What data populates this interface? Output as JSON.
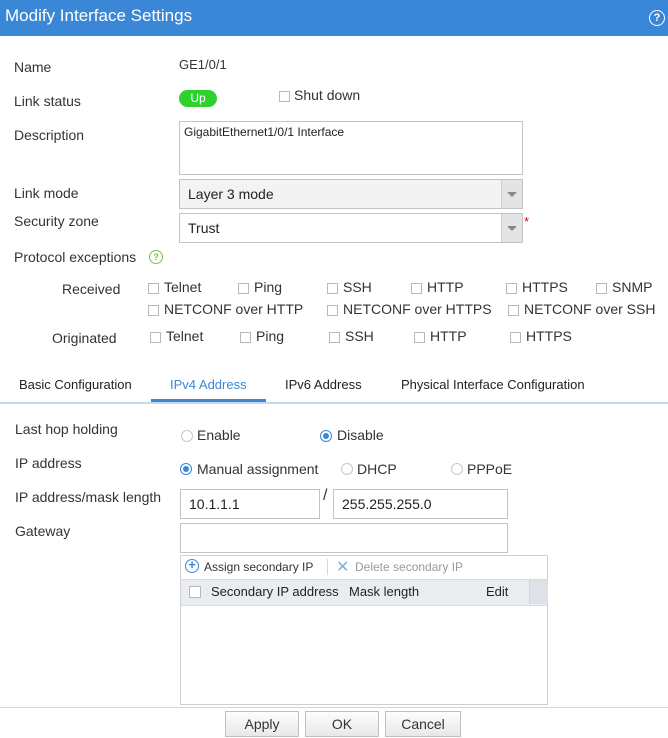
{
  "dialog": {
    "title": "Modify Interface Settings"
  },
  "form": {
    "name_label": "Name",
    "name_value": "GE1/0/1",
    "link_status_label": "Link status",
    "link_status_value": "Up",
    "shutdown_label": "Shut down",
    "description_label": "Description",
    "description_value": "GigabitEthernet1/0/1 Interface",
    "link_mode_label": "Link mode",
    "link_mode_value": "Layer 3 mode",
    "security_zone_label": "Security zone",
    "security_zone_value": "Trust",
    "required_mark": "*",
    "protocol_exceptions_label": "Protocol exceptions",
    "received_label": "Received",
    "received_row1": [
      "Telnet",
      "Ping",
      "SSH",
      "HTTP",
      "HTTPS",
      "SNMP"
    ],
    "received_row2": [
      "NETCONF over HTTP",
      "NETCONF over HTTPS",
      "NETCONF over SSH"
    ],
    "originated_label": "Originated",
    "originated": [
      "Telnet",
      "Ping",
      "SSH",
      "HTTP",
      "HTTPS"
    ]
  },
  "tabs": [
    "Basic Configuration",
    "IPv4 Address",
    "IPv6 Address",
    "Physical Interface Configuration"
  ],
  "ipv4": {
    "last_hop_label": "Last hop holding",
    "enable_label": "Enable",
    "disable_label": "Disable",
    "ip_address_label": "IP address",
    "manual_label": "Manual assignment",
    "dhcp_label": "DHCP",
    "pppoe_label": "PPPoE",
    "mask_label": "IP address/mask length",
    "ip_value": "10.1.1.1",
    "slash": "/",
    "mask_value": "255.255.255.0",
    "gateway_label": "Gateway",
    "gateway_value": "",
    "assign_secondary": "Assign secondary IP",
    "delete_secondary": "Delete secondary IP",
    "columns": [
      "Secondary IP address",
      "Mask length",
      "Edit"
    ]
  },
  "buttons": {
    "apply": "Apply",
    "ok": "OK",
    "cancel": "Cancel"
  },
  "colors": {
    "title_bar": "#3a87d8",
    "status_up": "#2fd12f",
    "active_tab": "#3a87d8"
  }
}
